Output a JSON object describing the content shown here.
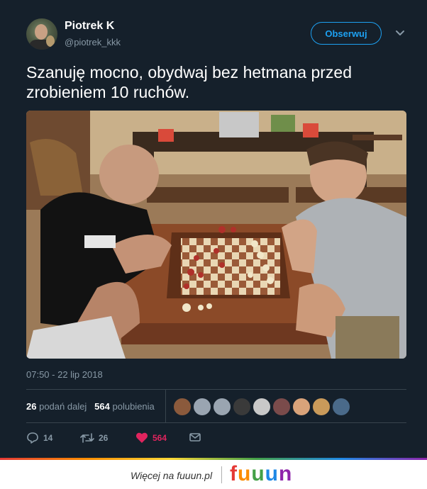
{
  "author": {
    "name": "Piotrek K",
    "handle": "@piotrek_kkk"
  },
  "follow_label": "Obserwuj",
  "tweet_text": "Szanuję mocno, obydwaj bez hetmana przed zrobieniem 10 ruchów.",
  "photo": {
    "subject": "two men playing chess at a wooden table"
  },
  "timestamp": "07:50 - 22 lip 2018",
  "stats": {
    "retweets_count": "26",
    "retweets_label": "podań dalej",
    "likes_count": "564",
    "likes_label": "polubienia"
  },
  "likers": [
    {
      "color": "#8b5a3c"
    },
    {
      "color": "#9aa5b1"
    },
    {
      "color": "#9aa5b1"
    },
    {
      "color": "#3a3a3a"
    },
    {
      "color": "#c8c8c8"
    },
    {
      "color": "#7a4b4b"
    },
    {
      "color": "#d9a37a"
    },
    {
      "color": "#c99a5a"
    },
    {
      "color": "#4a6a8a"
    }
  ],
  "actions": {
    "reply_count": "14",
    "retweet_count": "26",
    "like_count": "564"
  },
  "footer": {
    "more_text": "Więcej na fuuun.pl",
    "brand": "fuuun"
  },
  "colors": {
    "background": "#15202b",
    "accent": "#1da1f2",
    "like": "#e0245e",
    "muted": "#8899a6"
  }
}
